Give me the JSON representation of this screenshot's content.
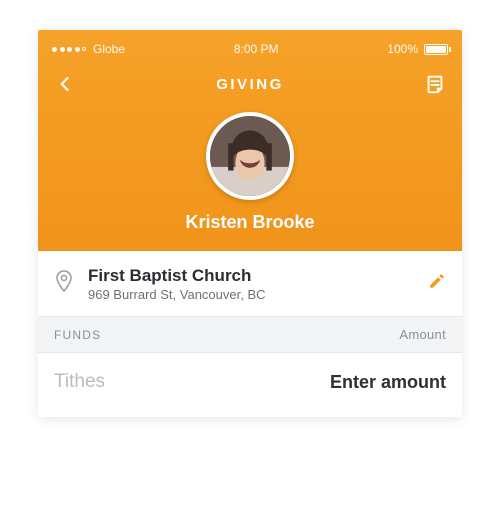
{
  "statusbar": {
    "carrier": "Globe",
    "time": "8:00 PM",
    "battery_pct": "100%"
  },
  "nav": {
    "title": "GIVING"
  },
  "profile": {
    "name": "Kristen Brooke"
  },
  "location": {
    "name": "First Baptist Church",
    "address": "969 Burrard St, Vancouver, BC"
  },
  "funds": {
    "header_left": "FUNDS",
    "header_right": "Amount",
    "rows": [
      {
        "name": "Tithes",
        "placeholder": "Enter amount",
        "value": ""
      }
    ]
  },
  "colors": {
    "accent": "#f39a1f"
  }
}
